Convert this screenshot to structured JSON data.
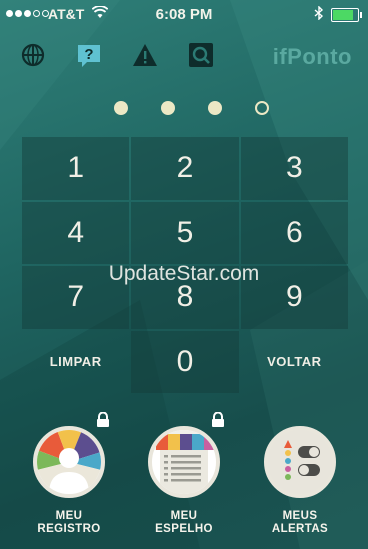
{
  "status_bar": {
    "carrier": "AT&T",
    "time": "6:08 PM",
    "bluetooth_icon": "bluetooth-icon",
    "battery_level_percent": 90,
    "battery_color": "#4cd964"
  },
  "topbar": {
    "icons": [
      "globe-icon",
      "help-icon",
      "alert-icon",
      "search-icon"
    ],
    "brand": "ifPonto"
  },
  "pin": {
    "total": 4,
    "filled": 3
  },
  "keypad": {
    "keys": [
      "1",
      "2",
      "3",
      "4",
      "5",
      "6",
      "7",
      "8",
      "9",
      "LIMPAR",
      "0",
      "VOLTAR"
    ]
  },
  "watermark": "UpdateStar.com",
  "features": [
    {
      "line1": "MEU",
      "line2": "REGISTRO",
      "locked": true,
      "icon": "person-icon"
    },
    {
      "line1": "MEU",
      "line2": "ESPELHO",
      "locked": true,
      "icon": "document-icon"
    },
    {
      "line1": "MEUS",
      "line2": "ALERTAS",
      "locked": false,
      "icon": "toggle-icon"
    }
  ]
}
